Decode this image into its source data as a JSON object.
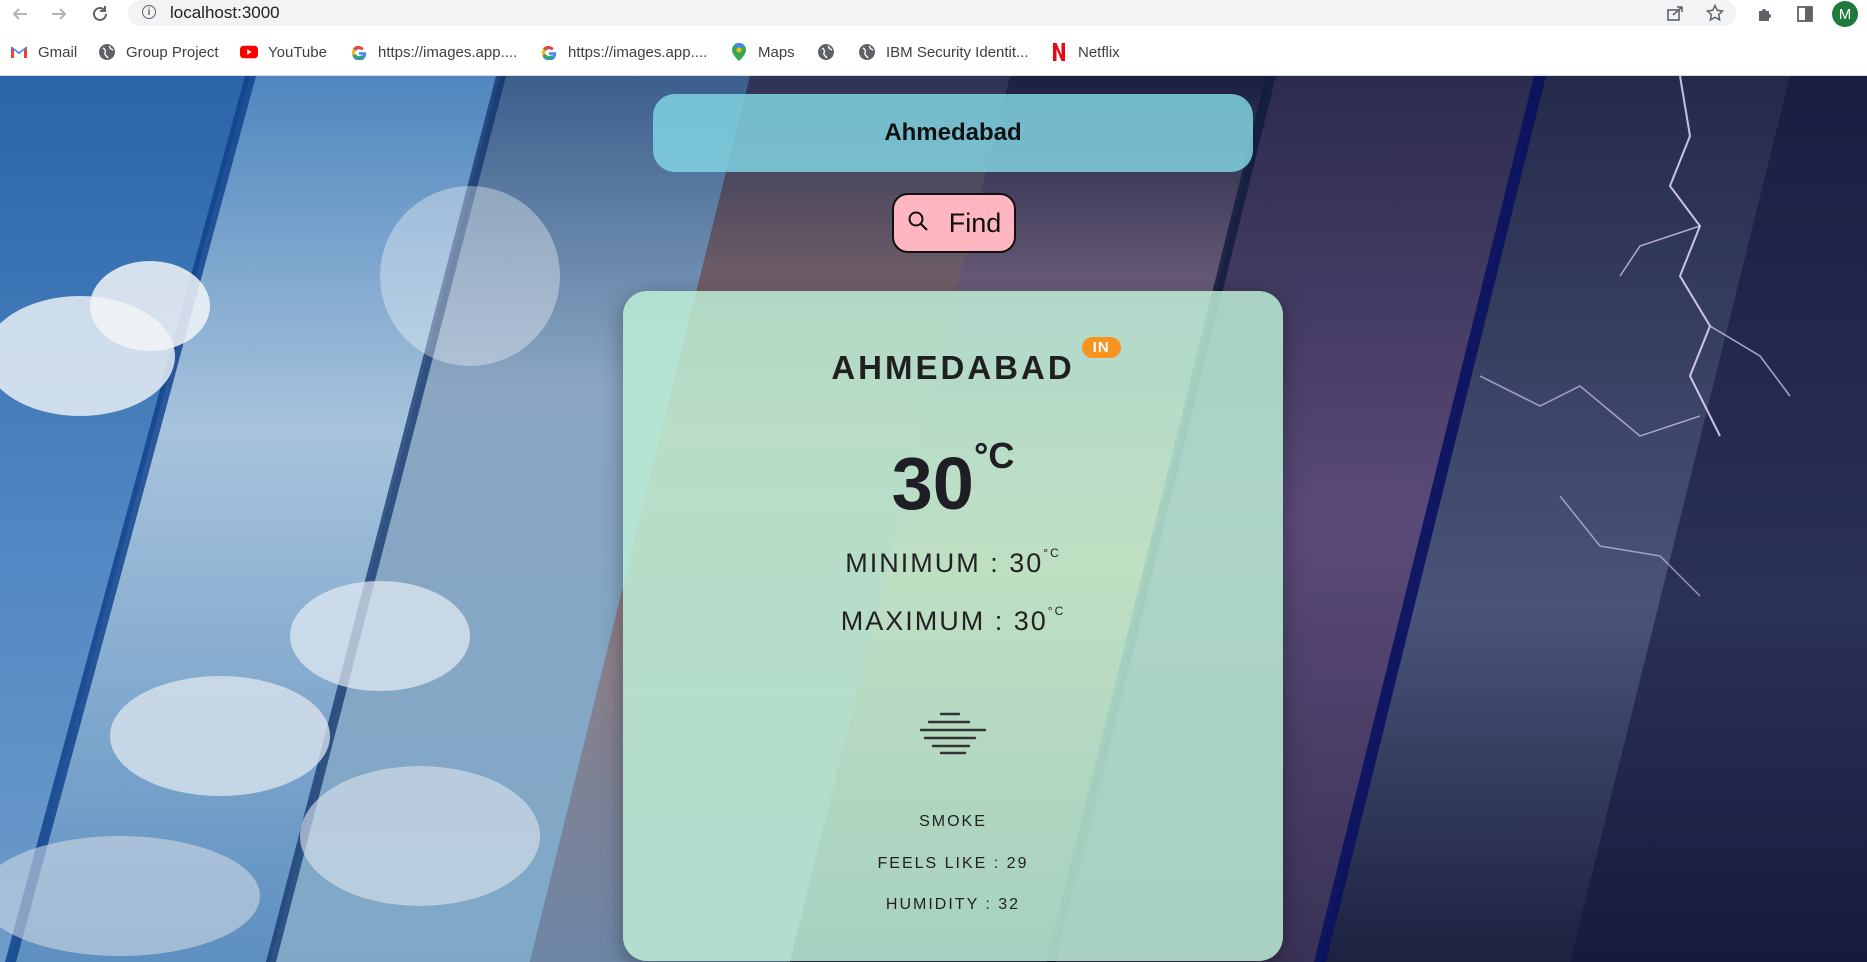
{
  "browser": {
    "url": "localhost:3000",
    "avatar_initial": "M",
    "bookmarks": [
      {
        "label": "Gmail",
        "icon": "gmail-icon"
      },
      {
        "label": "Group Project",
        "icon": "globe-icon"
      },
      {
        "label": "YouTube",
        "icon": "youtube-icon"
      },
      {
        "label": "https://images.app....",
        "icon": "google-icon"
      },
      {
        "label": "https://images.app....",
        "icon": "google-icon"
      },
      {
        "label": "Maps",
        "icon": "maps-icon"
      },
      {
        "label": "",
        "icon": "globe-icon"
      },
      {
        "label": "IBM Security Identit...",
        "icon": "globe-icon"
      },
      {
        "label": "Netflix",
        "icon": "netflix-icon"
      }
    ]
  },
  "search": {
    "value": "Ahmedabad",
    "button_label": "Find",
    "button_icon": "search-icon"
  },
  "weather": {
    "city": "AHMEDABAD",
    "country": "IN",
    "temp": "30",
    "temp_unit": "°C",
    "min_label": "MINIMUM : 30",
    "max_label": "MAXIMUM : 30",
    "unit_small": "°C",
    "condition_icon": "smoke-icon",
    "condition": "SMOKE",
    "feels_like": "FEELS LIKE : 29",
    "humidity": "HUMIDITY : 32"
  },
  "colors": {
    "search_bg": "#80d2e1",
    "find_bg": "#ffb6c1",
    "card_bg": "#bef0d7",
    "badge": "#f7931e"
  }
}
